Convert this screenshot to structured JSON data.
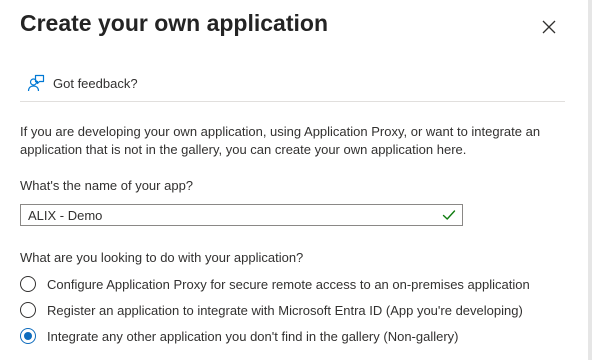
{
  "dialog": {
    "title": "Create your own application",
    "close_icon": "close-icon"
  },
  "feedback": {
    "icon": "person-feedback-icon",
    "label": "Got feedback?"
  },
  "description": "If you are developing your own application, using Application Proxy, or want to integrate an application that is not in the gallery, you can create your own application here.",
  "app_name": {
    "label": "What's the name of your app?",
    "value": "ALIX - Demo",
    "valid_icon": "checkmark-icon",
    "valid_color": "#107c10"
  },
  "purpose": {
    "label": "What are you looking to do with your application?",
    "options": [
      {
        "label": "Configure Application Proxy for secure remote access to an on-premises application",
        "selected": false
      },
      {
        "label": "Register an application to integrate with Microsoft Entra ID (App you're developing)",
        "selected": false
      },
      {
        "label": "Integrate any other application you don't find in the gallery (Non-gallery)",
        "selected": true
      }
    ]
  },
  "colors": {
    "accent": "#0f6cbd",
    "feedback_icon": "#0078d4"
  }
}
